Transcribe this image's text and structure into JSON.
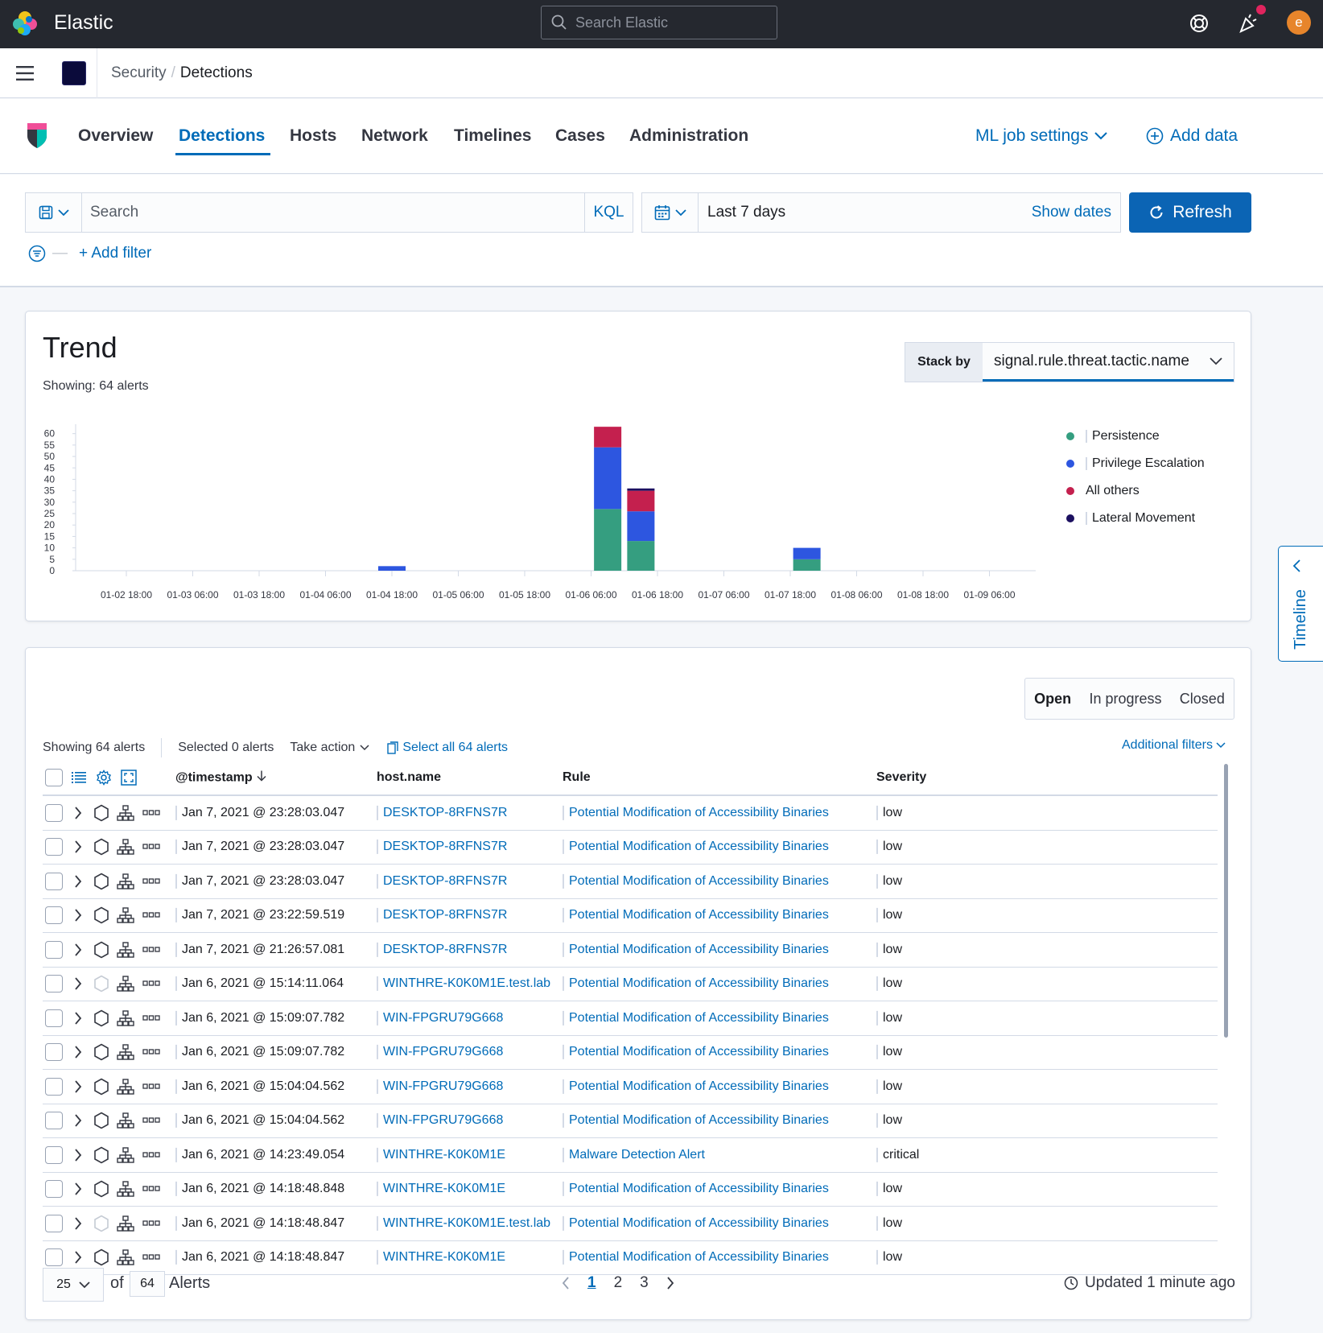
{
  "app": {
    "brand": "Elastic",
    "search_placeholder": "Search Elastic",
    "avatar_initial": "e"
  },
  "breadcrumbs": [
    "Security",
    "Detections"
  ],
  "nav": {
    "tabs": [
      "Overview",
      "Detections",
      "Hosts",
      "Network",
      "Timelines",
      "Cases",
      "Administration"
    ],
    "active": "Detections",
    "ml_settings": "ML job settings",
    "add_data": "Add data"
  },
  "query": {
    "search_placeholder": "Search",
    "language": "KQL",
    "time_range": "Last 7 days",
    "show_dates": "Show dates",
    "refresh": "Refresh",
    "add_filter": "+ Add filter"
  },
  "trend": {
    "title": "Trend",
    "subtitle": "Showing: 64 alerts",
    "stack_by_label": "Stack by",
    "stack_by_value": "signal.rule.threat.tactic.name"
  },
  "chart_data": {
    "type": "bar",
    "stacked": true,
    "yticks": [
      0,
      5,
      10,
      15,
      20,
      25,
      30,
      35,
      40,
      45,
      50,
      55,
      60
    ],
    "ylim": [
      0,
      62
    ],
    "xticks": [
      "01-02 18:00",
      "01-03 06:00",
      "01-03 18:00",
      "01-04 06:00",
      "01-04 18:00",
      "01-05 06:00",
      "01-05 18:00",
      "01-06 06:00",
      "01-06 18:00",
      "01-07 06:00",
      "01-07 18:00",
      "01-08 06:00",
      "01-08 18:00",
      "01-09 06:00"
    ],
    "legend_position": "right",
    "series": [
      {
        "name": "Persistence",
        "color": "#359e80"
      },
      {
        "name": "Privilege Escalation",
        "color": "#2d56e0"
      },
      {
        "name": "All others",
        "color": "#c4204e"
      },
      {
        "name": "Lateral Movement",
        "color": "#1c1060"
      }
    ],
    "bars": [
      {
        "x": "01-04 18:00",
        "values": {
          "Persistence": 0,
          "Privilege Escalation": 2,
          "All others": 0,
          "Lateral Movement": 0
        }
      },
      {
        "x": "01-06 09:00",
        "values": {
          "Persistence": 27,
          "Privilege Escalation": 27,
          "All others": 9,
          "Lateral Movement": 0
        }
      },
      {
        "x": "01-06 15:00",
        "values": {
          "Persistence": 13,
          "Privilege Escalation": 13,
          "All others": 9,
          "Lateral Movement": 1
        }
      },
      {
        "x": "01-07 21:00",
        "values": {
          "Persistence": 5,
          "Privilege Escalation": 5,
          "All others": 0,
          "Lateral Movement": 0
        }
      }
    ]
  },
  "alerts": {
    "status": [
      "Open",
      "In progress",
      "Closed"
    ],
    "showing": "Showing 64 alerts",
    "selected": "Selected 0 alerts",
    "take_action": "Take action",
    "select_all": "Select all 64 alerts",
    "additional_filters": "Additional filters",
    "columns": [
      "@timestamp",
      "host.name",
      "Rule",
      "Severity"
    ],
    "rows": [
      {
        "timestamp": "Jan 7, 2021 @ 23:28:03.047",
        "host": "DESKTOP-8RFNS7R",
        "rule": "Potential Modification of Accessibility Binaries",
        "severity": "low"
      },
      {
        "timestamp": "Jan 7, 2021 @ 23:28:03.047",
        "host": "DESKTOP-8RFNS7R",
        "rule": "Potential Modification of Accessibility Binaries",
        "severity": "low"
      },
      {
        "timestamp": "Jan 7, 2021 @ 23:28:03.047",
        "host": "DESKTOP-8RFNS7R",
        "rule": "Potential Modification of Accessibility Binaries",
        "severity": "low"
      },
      {
        "timestamp": "Jan 7, 2021 @ 23:22:59.519",
        "host": "DESKTOP-8RFNS7R",
        "rule": "Potential Modification of Accessibility Binaries",
        "severity": "low"
      },
      {
        "timestamp": "Jan 7, 2021 @ 21:26:57.081",
        "host": "DESKTOP-8RFNS7R",
        "rule": "Potential Modification of Accessibility Binaries",
        "severity": "low"
      },
      {
        "timestamp": "Jan 6, 2021 @ 15:14:11.064",
        "host": "WINTHRE-K0K0M1E.test.lab",
        "rule": "Potential Modification of Accessibility Binaries",
        "severity": "low"
      },
      {
        "timestamp": "Jan 6, 2021 @ 15:09:07.782",
        "host": "WIN-FPGRU79G668",
        "rule": "Potential Modification of Accessibility Binaries",
        "severity": "low"
      },
      {
        "timestamp": "Jan 6, 2021 @ 15:09:07.782",
        "host": "WIN-FPGRU79G668",
        "rule": "Potential Modification of Accessibility Binaries",
        "severity": "low"
      },
      {
        "timestamp": "Jan 6, 2021 @ 15:04:04.562",
        "host": "WIN-FPGRU79G668",
        "rule": "Potential Modification of Accessibility Binaries",
        "severity": "low"
      },
      {
        "timestamp": "Jan 6, 2021 @ 15:04:04.562",
        "host": "WIN-FPGRU79G668",
        "rule": "Potential Modification of Accessibility Binaries",
        "severity": "low"
      },
      {
        "timestamp": "Jan 6, 2021 @ 14:23:49.054",
        "host": "WINTHRE-K0K0M1E",
        "rule": "Malware Detection Alert",
        "severity": "critical"
      },
      {
        "timestamp": "Jan 6, 2021 @ 14:18:48.848",
        "host": "WINTHRE-K0K0M1E",
        "rule": "Potential Modification of Accessibility Binaries",
        "severity": "low"
      },
      {
        "timestamp": "Jan 6, 2021 @ 14:18:48.847",
        "host": "WINTHRE-K0K0M1E.test.lab",
        "rule": "Potential Modification of Accessibility Binaries",
        "severity": "low"
      },
      {
        "timestamp": "Jan 6, 2021 @ 14:18:48.847",
        "host": "WINTHRE-K0K0M1E",
        "rule": "Potential Modification of Accessibility Binaries",
        "severity": "low"
      }
    ],
    "pagination": {
      "per_page": "25",
      "of": "of",
      "total": "64",
      "unit": "Alerts",
      "pages": [
        "1",
        "2",
        "3"
      ],
      "current": "1",
      "updated": "Updated 1 minute ago"
    }
  },
  "timeline": {
    "label": "Timeline"
  }
}
